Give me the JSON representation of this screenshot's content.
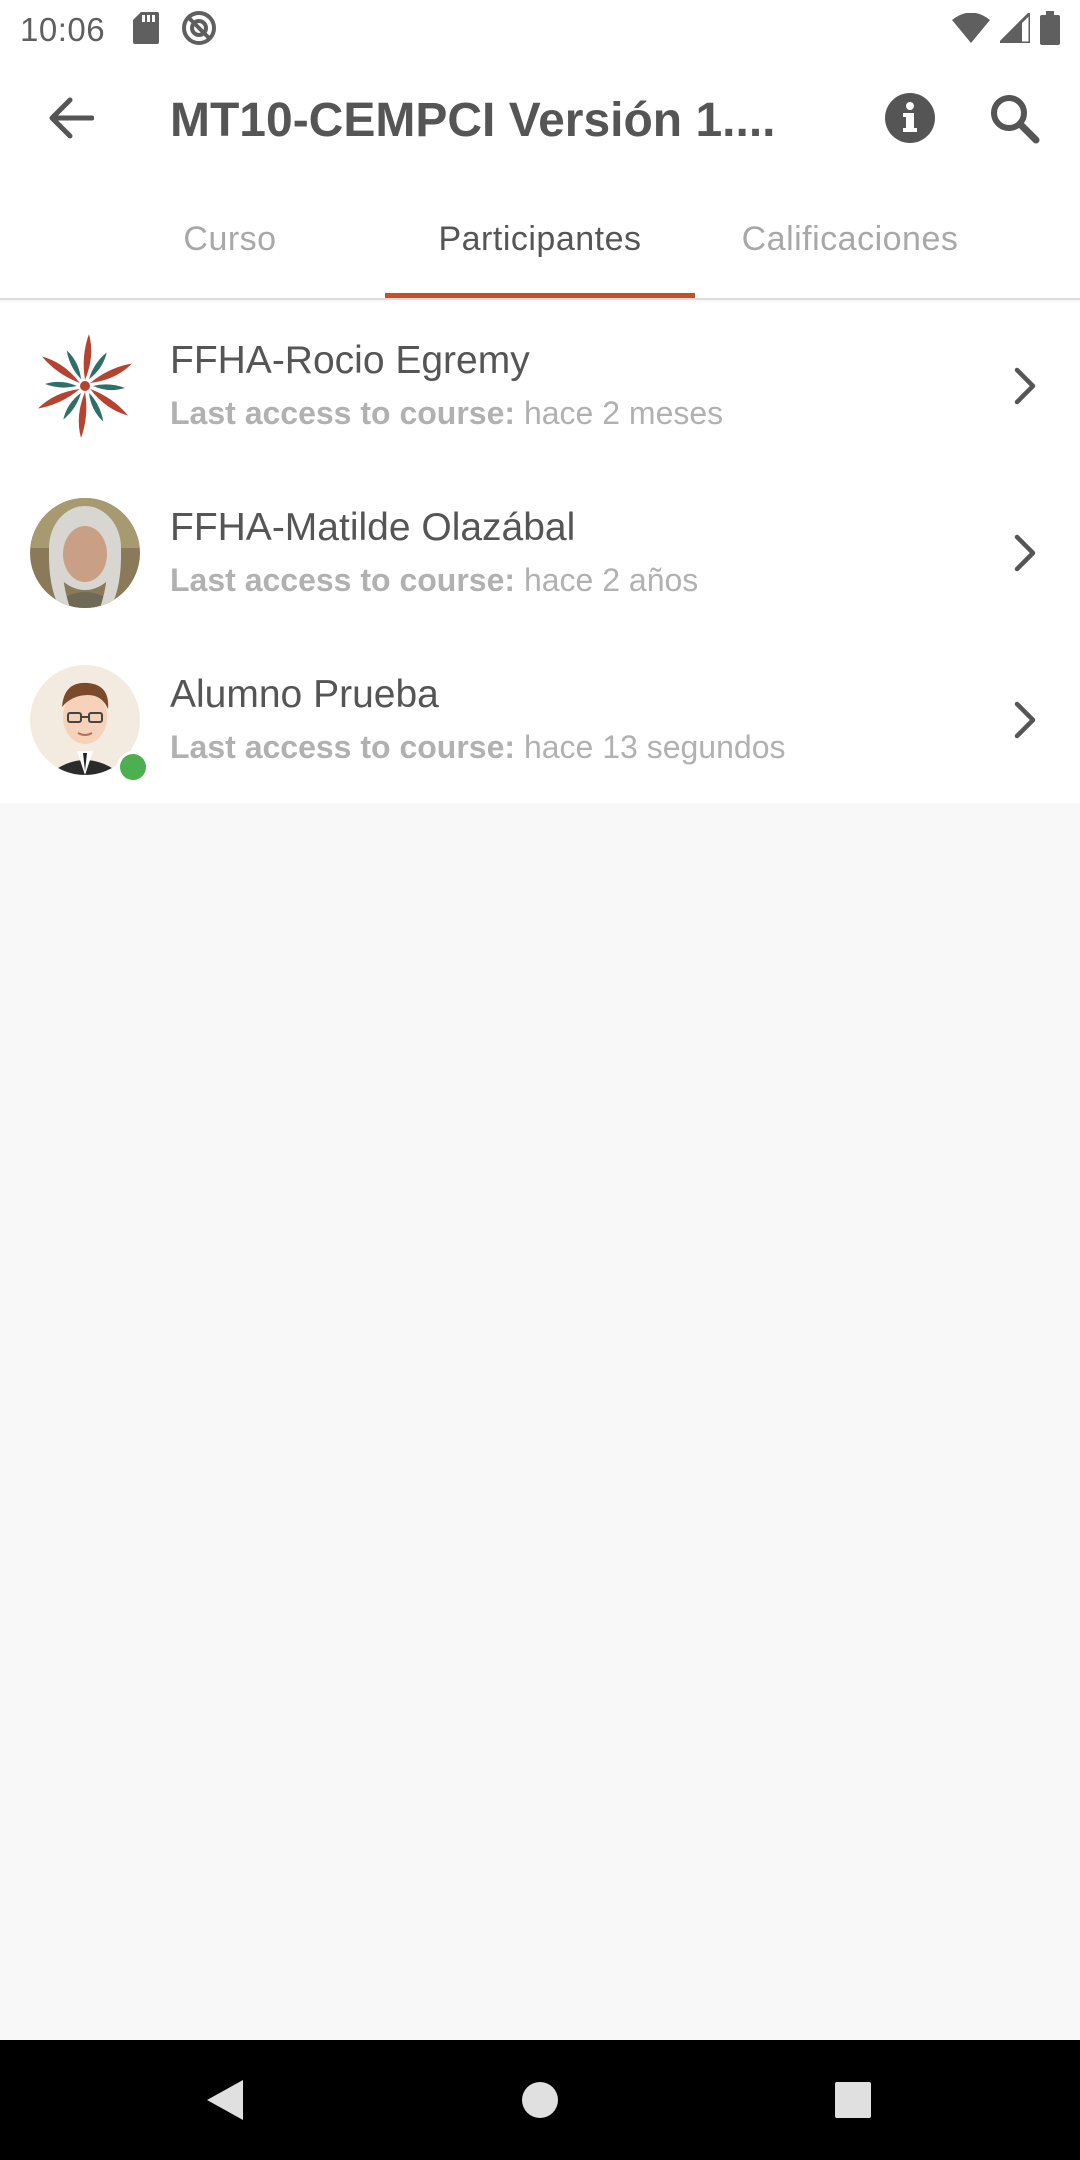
{
  "status_bar": {
    "time": "10:06",
    "left_icons": [
      "sd-card-icon",
      "no-sync-icon"
    ],
    "right_icons": [
      "wifi-icon",
      "signal-icon",
      "battery-icon"
    ]
  },
  "app_bar": {
    "title": "MT10-CEMPCI Versión 1....",
    "icons": [
      "back-arrow-icon",
      "info-icon",
      "search-icon"
    ]
  },
  "tabs": [
    {
      "label": "Curso",
      "active": false
    },
    {
      "label": "Participantes",
      "active": true
    },
    {
      "label": "Calificaciones",
      "active": false
    }
  ],
  "participants": [
    {
      "name": "FFHA-Rocio Egremy",
      "access_label": "Last access to course:",
      "access_value": "hace 2 meses",
      "avatar": "flower-logo",
      "online": false
    },
    {
      "name": "FFHA-Matilde Olazábal",
      "access_label": "Last access to course:",
      "access_value": "hace 2 años",
      "avatar": "photo-woman",
      "online": false
    },
    {
      "name": "Alumno Prueba",
      "access_label": "Last access to course:",
      "access_value": "hace 13 segundos",
      "avatar": "cartoon-man",
      "online": true
    }
  ],
  "colors": {
    "accent": "#c4502a",
    "online": "#4caf50",
    "background": "#f8f8f8"
  },
  "nav_bar": [
    "back-triangle-icon",
    "home-circle-icon",
    "recents-square-icon"
  ]
}
